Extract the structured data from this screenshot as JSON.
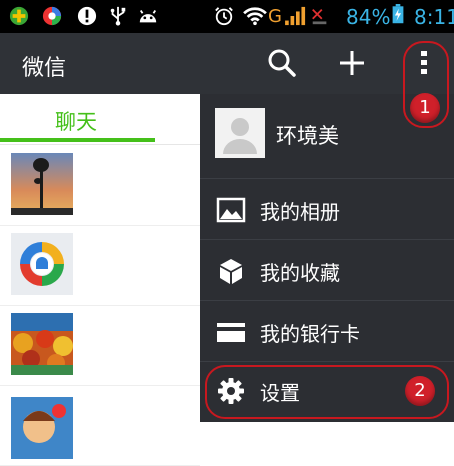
{
  "status_bar": {
    "icons": [
      "app-store-icon",
      "browser-icon",
      "alert-icon",
      "usb-icon",
      "android-icon",
      "alarm-icon",
      "wifi-icon",
      "signal-icon",
      "battery-icon"
    ],
    "network": "G",
    "battery": "84%",
    "time": "8:11"
  },
  "action_bar": {
    "title": "微信",
    "search_icon": "search-icon",
    "add_icon": "plus-icon",
    "more_icon": "more-vertical-icon"
  },
  "tabs": [
    {
      "label": "聊天",
      "selected": true
    }
  ],
  "chat_list": [
    {
      "thumbnail": "tree-sunset-photo"
    },
    {
      "thumbnail": "tencent-news-logo"
    },
    {
      "thumbnail": "autumn-landscape-photo"
    },
    {
      "thumbnail": "cartoon-photo"
    }
  ],
  "menu": {
    "profile_name": "环境美",
    "items": [
      {
        "label": "我的相册",
        "icon": "image-icon"
      },
      {
        "label": "我的收藏",
        "icon": "cube-icon"
      },
      {
        "label": "我的银行卡",
        "icon": "card-icon"
      },
      {
        "label": "设置",
        "icon": "gear-icon"
      }
    ]
  },
  "annotations": [
    {
      "label": "1"
    },
    {
      "label": "2"
    }
  ],
  "colors": {
    "accent": "#45c01a",
    "action_bar": "#2f3237",
    "menu_bg": "#2c2e33",
    "annotation": "#c8181f"
  }
}
